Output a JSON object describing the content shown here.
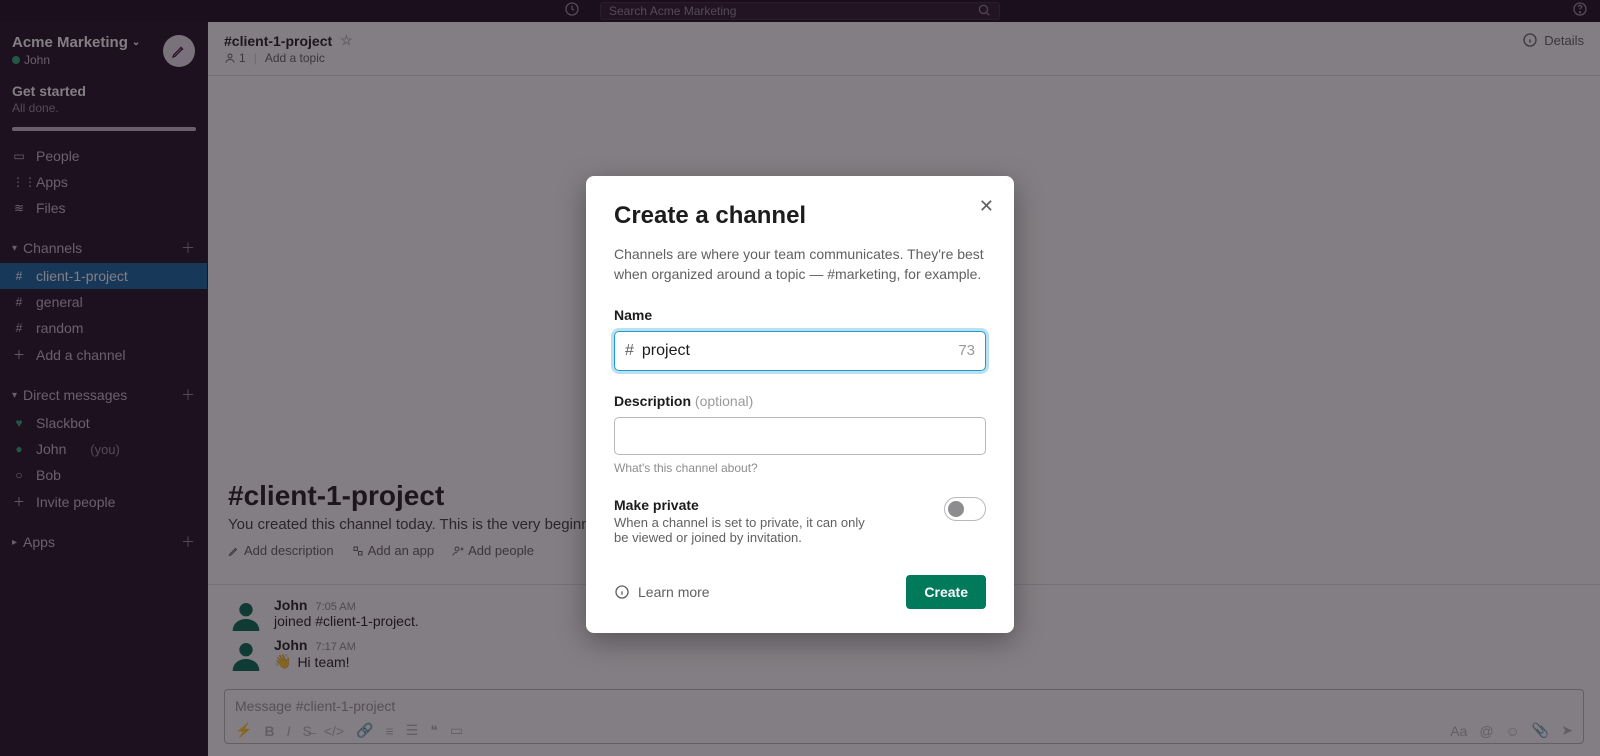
{
  "topbar": {
    "search_placeholder": "Search Acme Marketing"
  },
  "workspace": {
    "name": "Acme Marketing",
    "user": "John"
  },
  "get_started": {
    "title": "Get started",
    "subtitle": "All done."
  },
  "nav": {
    "people": "People",
    "apps": "Apps",
    "files": "Files"
  },
  "channels": {
    "header": "Channels",
    "items": [
      {
        "prefix": "#",
        "label": "client-1-project",
        "active": true
      },
      {
        "prefix": "#",
        "label": "general",
        "active": false
      },
      {
        "prefix": "#",
        "label": "random",
        "active": false
      }
    ],
    "add": "Add a channel"
  },
  "dms": {
    "header": "Direct messages",
    "items": [
      {
        "label": "Slackbot",
        "you": ""
      },
      {
        "label": "John",
        "you": "(you)"
      },
      {
        "label": "Bob",
        "you": ""
      }
    ],
    "invite": "Invite people"
  },
  "apps_section": {
    "header": "Apps"
  },
  "channel": {
    "title": "#client-1-project",
    "members": "1",
    "topic_prompt": "Add a topic",
    "details": "Details",
    "intro_title": "#client-1-project",
    "intro_text_visible": "You created this channel today. This is the very beginni",
    "actions": {
      "add_desc": "Add description",
      "add_app": "Add an app",
      "add_people": "Add people"
    }
  },
  "messages": [
    {
      "name": "John",
      "time": "7:05 AM",
      "body": "joined #client-1-project."
    },
    {
      "name": "John",
      "time": "7:17 AM",
      "body": "Hi team!"
    }
  ],
  "composer": {
    "placeholder": "Message #client-1-project"
  },
  "modal": {
    "title": "Create a channel",
    "description": "Channels are where your team communicates. They're best when organized around a topic — #marketing, for example.",
    "name_label": "Name",
    "name_value": "project",
    "name_count": "73",
    "desc_label": "Description",
    "desc_optional": "(optional)",
    "desc_hint": "What's this channel about?",
    "private_title": "Make private",
    "private_sub": "When a channel is set to private, it can only be viewed or joined by invitation.",
    "learn_more": "Learn more",
    "create": "Create"
  }
}
